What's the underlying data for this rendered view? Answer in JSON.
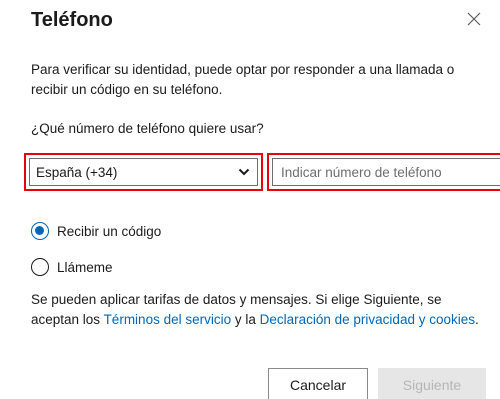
{
  "dialog": {
    "title": "Teléfono",
    "intro": "Para verificar su identidad, puede optar por responder a una llamada o recibir un código en su teléfono.",
    "question": "¿Qué número de teléfono quiere usar?"
  },
  "form": {
    "country_value": "España (+34)",
    "phone_placeholder": "Indicar número de teléfono",
    "phone_value": ""
  },
  "options": {
    "receive_code": "Recibir un código",
    "call_me": "Llámeme",
    "selected": "receive_code"
  },
  "disclaimer": {
    "before": "Se pueden aplicar tarifas de datos y mensajes. Si elige Siguiente, se aceptan los ",
    "terms_link": "Términos del servicio",
    "middle": " y la ",
    "privacy_link": "Declaración de privacidad y cookies",
    "after": "."
  },
  "buttons": {
    "cancel": "Cancelar",
    "next": "Siguiente"
  },
  "colors": {
    "accent": "#0067b8",
    "highlight": "#e8000b",
    "disabled_bg": "#e6e6e6"
  },
  "icons": {
    "close": "close-icon",
    "dropdown": "chevron-down-icon"
  }
}
